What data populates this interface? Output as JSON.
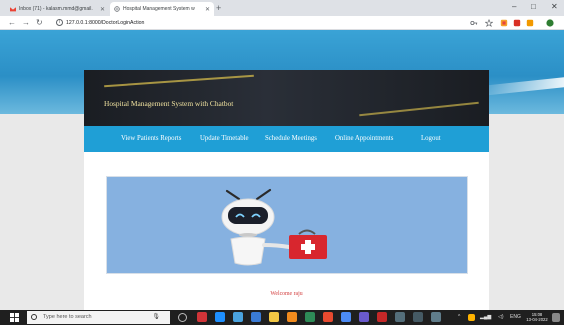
{
  "browser": {
    "tabs": [
      {
        "title": "Inbox (71) - kalasm.mmd@gmail.",
        "active": false
      },
      {
        "title": "Hospital Management System w",
        "active": true
      }
    ],
    "new_tab": "+",
    "address": "127.0.0.1:8000/DoctorLoginAction",
    "window_controls": {
      "minimize": "–",
      "maximize": "□",
      "close": "✕"
    }
  },
  "site": {
    "title": "Hospital Management System with Chatbot",
    "menu": [
      "View Patients Reports",
      "Update Timetable",
      "Schedule Meetings",
      "Online Appointments",
      "Logout"
    ],
    "welcome": "Welcome raju"
  },
  "taskbar": {
    "search_placeholder": "Type here to search",
    "tray_text": "ENG",
    "time": "15:08",
    "date": "13-04-2022"
  },
  "colors": {
    "sky": "#2b8fc6",
    "menubar": "#1f9fd6",
    "header_dark": "#1a1d22",
    "header_text": "#f1e3a0",
    "banner": "#86b1e0",
    "welcome": "#d23c3c"
  }
}
